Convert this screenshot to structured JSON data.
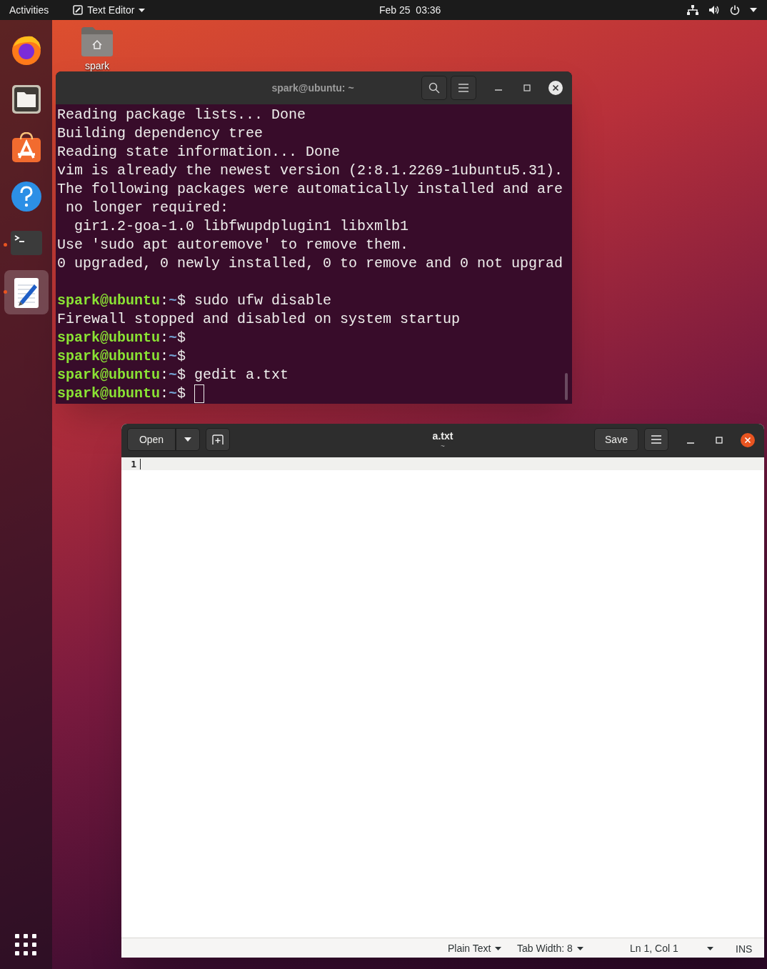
{
  "top_bar": {
    "activities": "Activities",
    "app_menu": "Text Editor",
    "clock": "Feb 25  03:36"
  },
  "dock": {
    "items": [
      {
        "kind": "browser",
        "running": false,
        "selected": false
      },
      {
        "kind": "files",
        "running": false,
        "selected": false
      },
      {
        "kind": "software",
        "running": false,
        "selected": false
      },
      {
        "kind": "help",
        "running": false,
        "selected": false
      },
      {
        "kind": "terminal",
        "running": true,
        "selected": false
      },
      {
        "kind": "editor",
        "running": true,
        "selected": true
      }
    ]
  },
  "desktop_icons": [
    {
      "label": "spark"
    }
  ],
  "terminal": {
    "title": "spark@ubuntu: ~",
    "lines": [
      {
        "kind": "output",
        "text": "Reading package lists... Done"
      },
      {
        "kind": "output",
        "text": "Building dependency tree"
      },
      {
        "kind": "output",
        "text": "Reading state information... Done"
      },
      {
        "kind": "output",
        "text": "vim is already the newest version (2:8.1.2269-1ubuntu5.31)."
      },
      {
        "kind": "output",
        "text": "The following packages were automatically installed and are"
      },
      {
        "kind": "output",
        "text": " no longer required:"
      },
      {
        "kind": "output",
        "text": "  gir1.2-goa-1.0 libfwupdplugin1 libxmlb1"
      },
      {
        "kind": "output",
        "text": "Use 'sudo apt autoremove' to remove them."
      },
      {
        "kind": "output",
        "text": "0 upgraded, 0 newly installed, 0 to remove and 0 not upgrad"
      },
      {
        "kind": "blank"
      },
      {
        "kind": "prompt",
        "user": "spark@ubuntu",
        "separator": ":",
        "path": "~",
        "symbol": "$",
        "command": " sudo ufw disable",
        "cursor": false
      },
      {
        "kind": "output",
        "text": "Firewall stopped and disabled on system startup"
      },
      {
        "kind": "prompt",
        "user": "spark@ubuntu",
        "separator": ":",
        "path": "~",
        "symbol": "$",
        "cursor": false
      },
      {
        "kind": "prompt",
        "user": "spark@ubuntu",
        "separator": ":",
        "path": "~",
        "symbol": "$",
        "cursor": false
      },
      {
        "kind": "prompt",
        "user": "spark@ubuntu",
        "separator": ":",
        "path": "~",
        "symbol": "$",
        "command": " gedit a.txt",
        "cursor": false
      },
      {
        "kind": "prompt",
        "user": "spark@ubuntu",
        "separator": ":",
        "path": "~",
        "symbol": "$",
        "cursor": true
      }
    ]
  },
  "editor": {
    "open_button": "Open",
    "title": "a.txt",
    "subtitle": "~",
    "save_button": "Save",
    "line_numbers": [
      "1"
    ],
    "status_bar": {
      "language": "Plain Text",
      "tab_width": "Tab Width: 8",
      "position": "Ln 1, Col 1",
      "mode": "INS"
    }
  }
}
